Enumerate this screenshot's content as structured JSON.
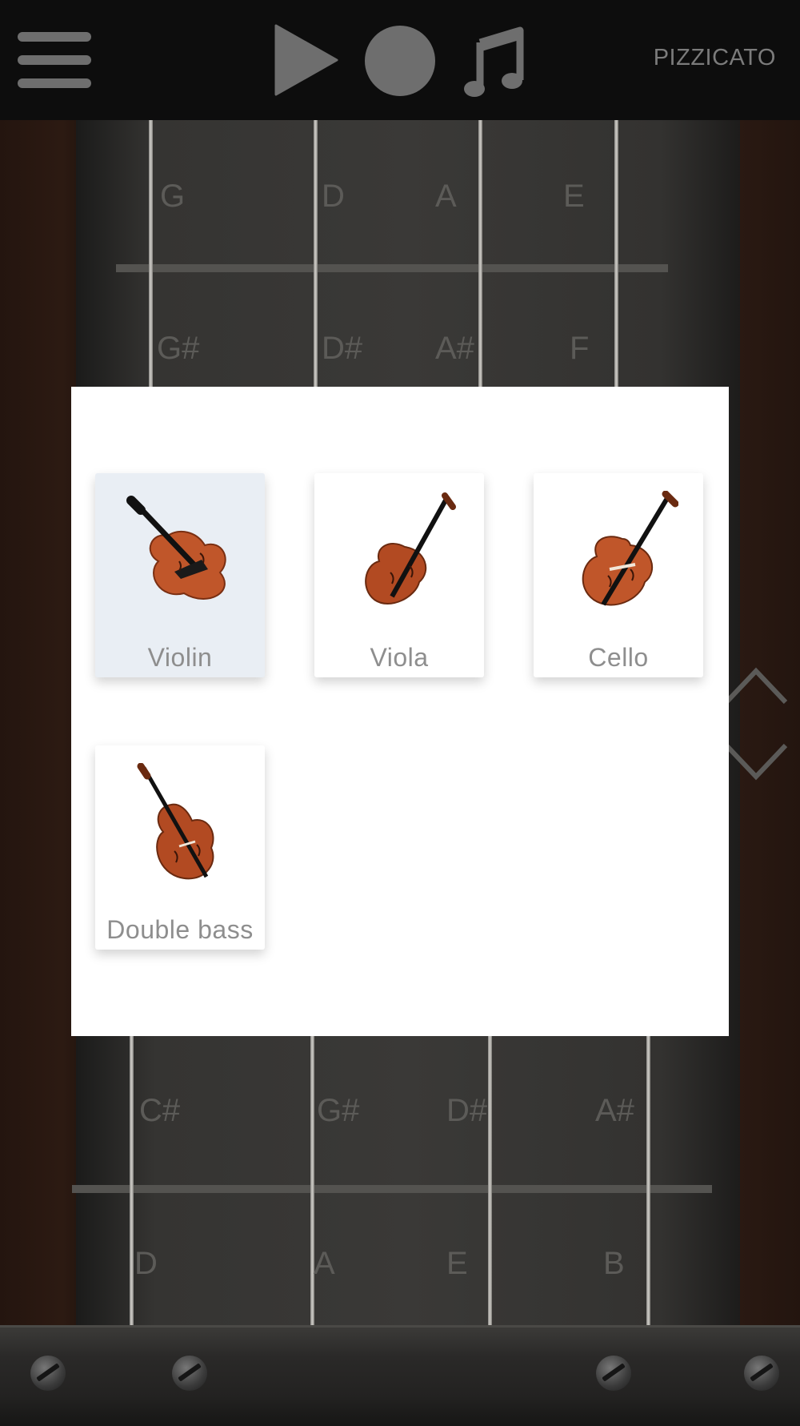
{
  "top_bar": {
    "menu_icon": "hamburger-menu-icon",
    "play_icon": "play-icon",
    "record_icon": "record-icon",
    "music_icon": "music-note-icon",
    "mode_label": "PIZZICATO"
  },
  "fingerboard": {
    "notes_top": [
      "G",
      "D",
      "A",
      "E"
    ],
    "notes_row2": [
      "G#",
      "D#",
      "A#",
      "F"
    ],
    "notes_row3": [
      "C#",
      "G#",
      "D#",
      "A#"
    ],
    "notes_row4": [
      "D",
      "A",
      "E",
      "B"
    ]
  },
  "instrument_dialog": {
    "instruments": [
      {
        "label": "Violin",
        "icon": "violin-icon",
        "selected": true
      },
      {
        "label": "Viola",
        "icon": "viola-icon",
        "selected": false
      },
      {
        "label": "Cello",
        "icon": "cello-icon",
        "selected": false
      },
      {
        "label": "Double bass",
        "icon": "double-bass-icon",
        "selected": false
      }
    ]
  },
  "colors": {
    "top_bar_bg": "#0d0d0d",
    "icon_gray": "#6e6e6e",
    "selected_card_bg": "#e9eef4",
    "wood": "#c0562a"
  }
}
